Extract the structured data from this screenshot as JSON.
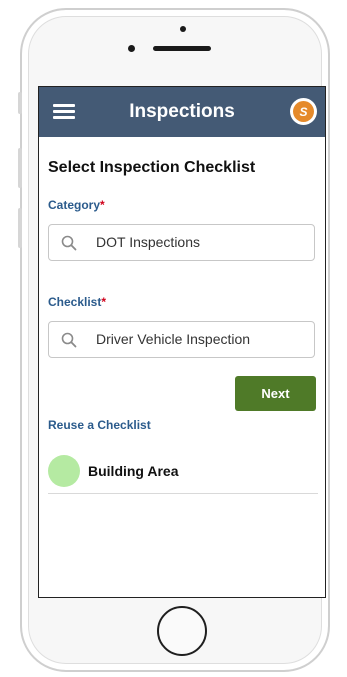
{
  "app": {
    "title": "Inspections",
    "logo_text": "S"
  },
  "form": {
    "heading": "Select Inspection Checklist",
    "category": {
      "label": "Category",
      "required_mark": "*",
      "value": "DOT Inspections"
    },
    "checklist": {
      "label": "Checklist",
      "required_mark": "*",
      "value": "Driver Vehicle Inspection"
    },
    "next_label": "Next"
  },
  "reuse": {
    "title": "Reuse a Checklist",
    "items": [
      {
        "label": "Building Area",
        "color": "#b5eaa2"
      }
    ]
  },
  "colors": {
    "appbar": "#445a75",
    "next_button": "#4f7a28",
    "label_blue": "#2b5b8c",
    "required_red": "#d0021b",
    "logo_orange": "#e58a2b"
  }
}
